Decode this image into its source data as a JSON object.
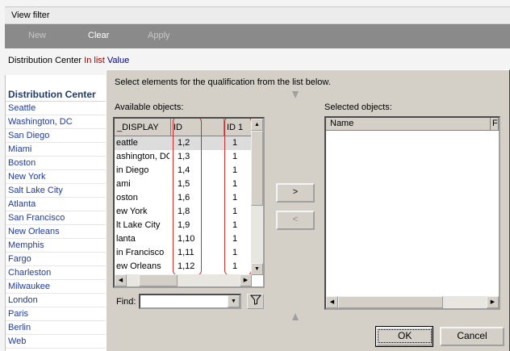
{
  "view_filter": {
    "title": "View filter"
  },
  "toolbar": {
    "new_label": "New",
    "clear_label": "Clear",
    "apply_label": "Apply"
  },
  "condition": {
    "attribute": "Distribution Center",
    "operator": "In list",
    "value": "Value"
  },
  "left_list": {
    "header": "Distribution Center",
    "items": [
      "Seattle",
      "Washington, DC",
      "San Diego",
      "Miami",
      "Boston",
      "New York",
      "Salt Lake City",
      "Atlanta",
      "San Francisco",
      "New Orleans",
      "Memphis",
      "Fargo",
      "Charleston",
      "Milwaukee",
      "London",
      "Paris",
      "Berlin",
      "Web"
    ]
  },
  "dialog": {
    "instruction": "Select elements for the qualification from the list below.",
    "available_label": "Available objects:",
    "selected_label": "Selected objects:",
    "available_columns": [
      "_DISPLAY",
      "ID",
      "ID 1"
    ],
    "available_rows": [
      [
        "eattle",
        "1,2",
        "1"
      ],
      [
        "ashington, DC",
        "1,3",
        "1"
      ],
      [
        "in Diego",
        "1,4",
        "1"
      ],
      [
        "ami",
        "1,5",
        "1"
      ],
      [
        "oston",
        "1,6",
        "1"
      ],
      [
        "ew York",
        "1,8",
        "1"
      ],
      [
        "lt Lake City",
        "1,9",
        "1"
      ],
      [
        "lanta",
        "1,10",
        "1"
      ],
      [
        "in Francisco",
        "1,11",
        "1"
      ],
      [
        "ew Orleans",
        "1,12",
        "1"
      ]
    ],
    "selected_columns": [
      "Name",
      "F"
    ],
    "add_label": ">",
    "remove_label": "<",
    "find_label": "Find:",
    "find_value": "",
    "ok_label": "OK",
    "cancel_label": "Cancel"
  },
  "colors": {
    "highlight_box": "#d42a2a",
    "toolbar_bg": "#8a8a8a",
    "link_text": "#1f3aa0"
  }
}
